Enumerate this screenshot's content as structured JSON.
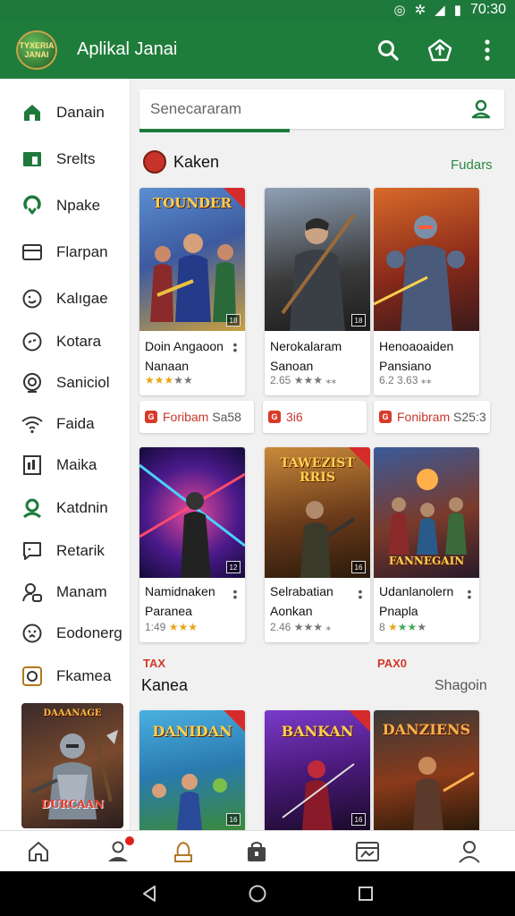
{
  "status_bar": {
    "time": "70:30"
  },
  "app_bar": {
    "logo_text": "Tyxeria Janai",
    "title": "Aplikal Janai",
    "actions": [
      "search-icon",
      "share-icon",
      "overflow-icon"
    ]
  },
  "drawer": {
    "items": [
      {
        "label": "Danain",
        "icon": "home-icon"
      },
      {
        "label": "Srelts",
        "icon": "store-icon"
      },
      {
        "label": "Npake",
        "icon": "refresh-icon"
      },
      {
        "label": "Flarpan",
        "icon": "card-icon"
      },
      {
        "label": "Kalıgae",
        "icon": "smile-icon"
      },
      {
        "label": "Kotara",
        "icon": "face-icon"
      },
      {
        "label": "Saniciol",
        "icon": "target-icon"
      },
      {
        "label": "Faida",
        "icon": "wifi-icon"
      },
      {
        "label": "Maika",
        "icon": "document-icon"
      },
      {
        "label": "Katdnin",
        "icon": "person-icon"
      },
      {
        "label": "Retarik",
        "icon": "chat-icon"
      },
      {
        "label": "Manam",
        "icon": "group-icon"
      },
      {
        "label": "Eodonerg",
        "icon": "emoji-icon"
      },
      {
        "label": "Fkamea",
        "icon": "camera-icon"
      }
    ],
    "promo_title": "DAAANAGE",
    "promo_subtitle": "DURCAAN"
  },
  "search": {
    "placeholder": "Senecararam"
  },
  "section1": {
    "title": "Kaken",
    "link": "Fudars",
    "cards": [
      {
        "art_title": "TOUNDER",
        "name": "Doin Angaoon Nanaan",
        "rating": "",
        "stars": 3
      },
      {
        "art_title": "",
        "name": "Nerokalaram Sanoan",
        "rating": "2.65",
        "stars": 0
      },
      {
        "art_title": "",
        "name": "Henoaoaiden Pansiano",
        "rating": "6.2 3.63",
        "stars": 0
      }
    ],
    "prices": [
      {
        "label": "Foribam",
        "value": "Sa58"
      },
      {
        "label": "",
        "value": "3i6"
      },
      {
        "label": "Fonibram",
        "value": "S25:3"
      }
    ],
    "cards_row2": [
      {
        "art_title": "",
        "name": "Namidnaken Paranea",
        "rating": "1:49",
        "stars": 3
      },
      {
        "art_title": "TAWEZIST RRIS",
        "name": "Selrabatian Aonkan",
        "rating": "2.46",
        "stars": 0
      },
      {
        "art_title": "FANNEGAIN",
        "name": "Udanlanolern Pnapla",
        "rating": "8",
        "stars": 4
      }
    ]
  },
  "section2": {
    "tag_left": "TAX",
    "tag_right": "PAX0",
    "title": "Kanea",
    "link": "Shagoin",
    "cards": [
      {
        "art_title": "DANIDAN"
      },
      {
        "art_title": "BANKAN"
      },
      {
        "art_title": "DANZIENS"
      }
    ]
  },
  "bottom_nav": [
    "home-icon",
    "account-icon",
    "games-icon",
    "bag-icon",
    "news-icon",
    "profile-icon"
  ],
  "colors": {
    "primary": "#1f7d3b",
    "accent_red": "#d03a2a",
    "star": "#e6a817"
  }
}
